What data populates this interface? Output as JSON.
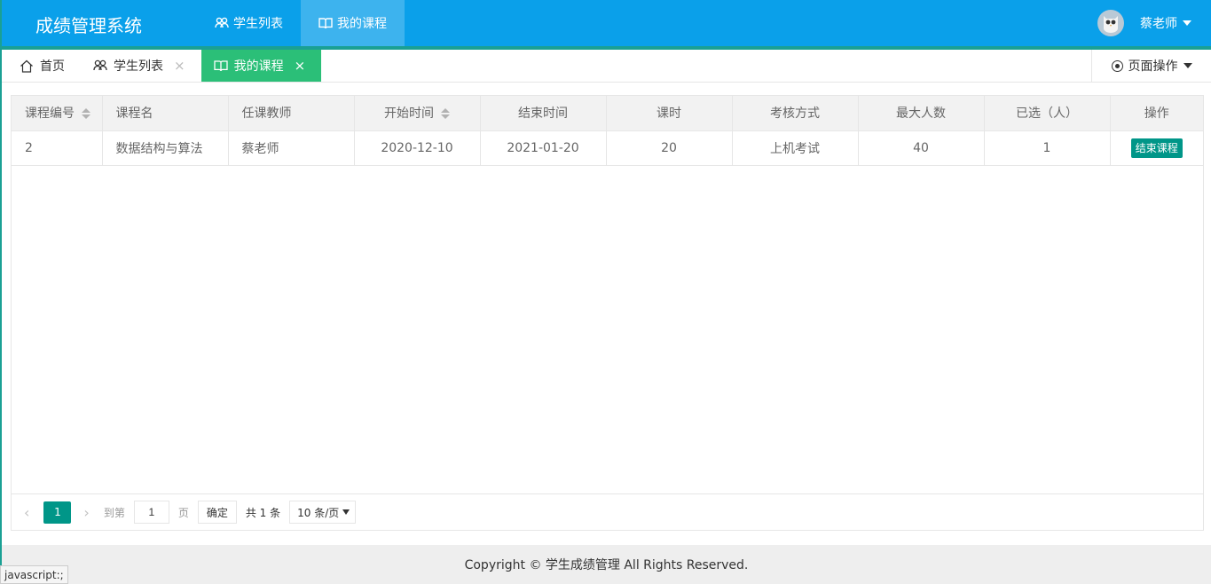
{
  "app": {
    "title": "成绩管理系统"
  },
  "topnav": [
    {
      "label": "学生列表",
      "icon": "users-icon",
      "active": false
    },
    {
      "label": "我的课程",
      "icon": "book-icon",
      "active": true
    }
  ],
  "user": {
    "name": "蔡老师"
  },
  "tabs": [
    {
      "label": "首页",
      "icon": "home-icon"
    },
    {
      "label": "学生列表",
      "icon": "users-icon",
      "close": "×"
    },
    {
      "label": "我的课程",
      "icon": "book-icon",
      "close": "×"
    }
  ],
  "page_ops": {
    "label": "页面操作"
  },
  "table": {
    "columns": [
      "课程编号",
      "课程名",
      "任课教师",
      "开始时间",
      "结束时间",
      "课时",
      "考核方式",
      "最大人数",
      "已选（人）",
      "操作"
    ],
    "rows": [
      {
        "id": "2",
        "name": "数据结构与算法",
        "teacher": "蔡老师",
        "start": "2020-12-10",
        "end": "2021-01-20",
        "hours": "20",
        "exam": "上机考试",
        "max": "40",
        "selected": "1",
        "action": "结束课程"
      }
    ]
  },
  "pager": {
    "prev": "‹",
    "current": "1",
    "next": "›",
    "goto_label": "到第",
    "goto_value": "1",
    "page_unit": "页",
    "confirm": "确定",
    "total": "共 1 条",
    "page_size": "10 条/页"
  },
  "footer": {
    "text": "Copyright © 学生成绩管理 All Rights Reserved."
  },
  "status_bar": {
    "text": "javascript:;"
  },
  "colors": {
    "header": "#0aa0ea",
    "accent": "#1aa094",
    "active_tab": "#2bbf78",
    "button": "#009688"
  }
}
